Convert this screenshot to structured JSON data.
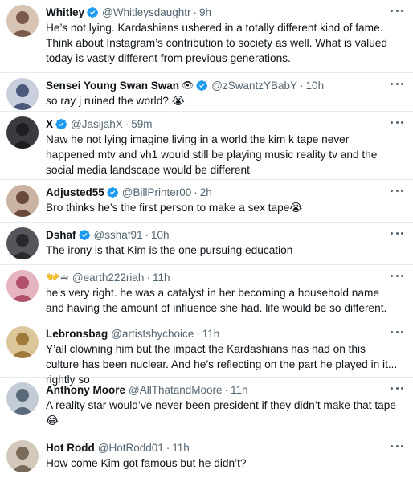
{
  "tweets": [
    {
      "name": "Whitley",
      "verified": true,
      "handle": "@Whitleysdaughtr",
      "time": "9h",
      "text": "He’s not lying. Kardashians ushered in a totally different kind of fame. Think about Instagram’s contribution to society as well. What is valued today is vastly different from previous generations.",
      "avatar_color": "#7a5a4a"
    },
    {
      "name": "Sensei Young Swan Swan",
      "name_emoji": "👁",
      "verified": true,
      "handle": "@zSwantzYBabY",
      "time": "10h",
      "text": "so ray j ruined the world? 😭",
      "avatar_color": "#4b5a7a"
    },
    {
      "name": "X",
      "verified": true,
      "handle": "@JasijahX",
      "time": "59m",
      "text": "Naw he not lying imagine living in a world the kim k tape never happened mtv and vh1 would still be playing music reality tv and the social media landscape would be different",
      "avatar_color": "#1e1e22"
    },
    {
      "name": "Adjusted55",
      "verified": true,
      "handle": "@BillPrinter00",
      "time": "2h",
      "text": "Bro thinks he’s the first person to make a sex tape😭",
      "avatar_color": "#6a4a3a"
    },
    {
      "name": "Dshaf",
      "verified": true,
      "handle": "@sshaf91",
      "time": "10h",
      "text": "The irony is that Kim is the one pursuing education",
      "avatar_color": "#2a2a2e"
    },
    {
      "name": "👐☕",
      "verified": false,
      "handle": "@earth222riah",
      "time": "11h",
      "text": "he's very right. he was a catalyst in her becoming a household name and having the amount of influence she had. life would be so different.",
      "avatar_color": "#b0506a"
    },
    {
      "name": "Lebronsbag",
      "verified": false,
      "handle": "@artistsbychoice",
      "time": "11h",
      "text": "Y’all clowning him but the impact the Kardashians has had on this culture has been nuclear.  And he’s reflecting on the part he played in it... rightly so",
      "avatar_color": "#a07a3a"
    },
    {
      "name": "Anthony Moore",
      "verified": false,
      "handle": "@AllThatandMoore",
      "time": "11h",
      "text": "A reality star would’ve never been president if they didn’t make that tape 😂",
      "avatar_color": "#5a6a7a"
    },
    {
      "name": "Hot Rodd",
      "verified": false,
      "handle": "@HotRodd01",
      "time": "11h",
      "text": "How come Kim got famous but he didn’t?",
      "avatar_color": "#7a6a5a"
    }
  ],
  "colors": {
    "verified": "#1d9bf0",
    "secondary": "#536471",
    "divider": "#e6ecf0"
  }
}
